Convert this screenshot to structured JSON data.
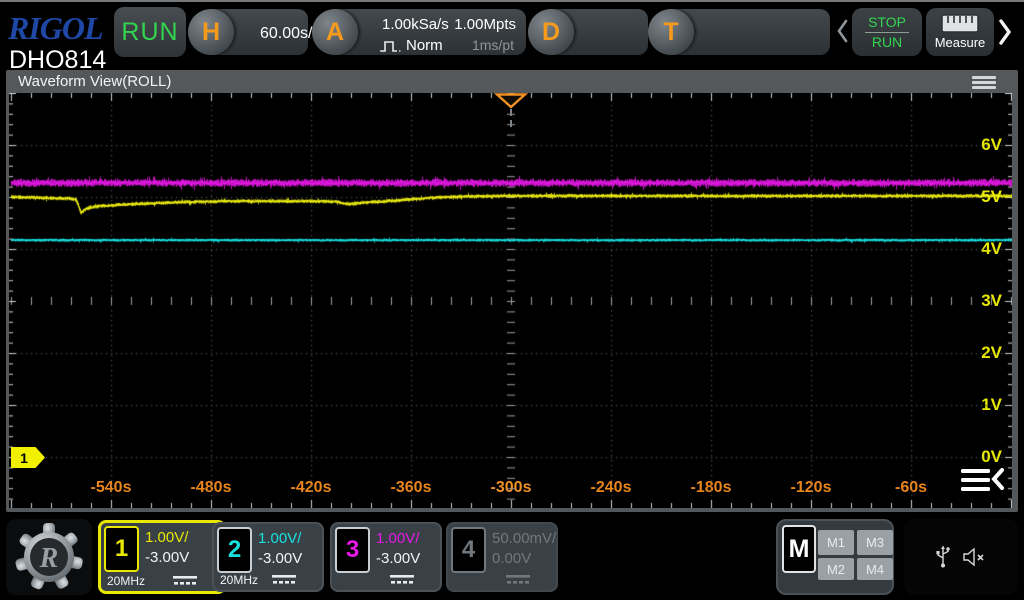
{
  "header": {
    "brand": "RIGOL",
    "model": "DHO814",
    "acq_state": "RUN",
    "horizontal": {
      "letter": "H",
      "timebase": "60.00s/"
    },
    "acquire": {
      "letter": "A",
      "sample_rate": "1.00kSa/s",
      "trigger_mode": "Norm",
      "mode_icon": "pulse-icon",
      "memory_depth": "1.00Mpts",
      "time_per_point": "1ms/pt"
    },
    "decode": {
      "letter": "D"
    },
    "trigger": {
      "letter": "T"
    },
    "stop_run_button": {
      "top": "STOP",
      "bottom": "RUN"
    },
    "measure_button": {
      "label": "Measure",
      "icon": "ruler-icon"
    },
    "nav_icons": [
      "prev-chevron-icon",
      "next-chevron-icon"
    ]
  },
  "panel": {
    "title": "Waveform View(ROLL)",
    "menu_icon": "hamburger-icon"
  },
  "chart_data": {
    "type": "line",
    "title": "Waveform View (ROLL)",
    "grid": "dotted",
    "x_axis": {
      "unit": "s",
      "range": [
        -600,
        0
      ],
      "seconds_per_div": 60,
      "tick_values": [
        -540,
        -480,
        -420,
        -360,
        -300,
        -240,
        -180,
        -120,
        -60
      ],
      "tick_labels": [
        "-540s",
        "-480s",
        "-420s",
        "-360s",
        "-300s",
        "-240s",
        "-180s",
        "-120s",
        "-60s"
      ]
    },
    "y_axis": {
      "unit": "V",
      "range": [
        -1,
        7
      ],
      "volts_per_div": 1,
      "tick_values": [
        6,
        5,
        4,
        3,
        2,
        1,
        0
      ],
      "tick_labels": [
        "6V",
        "5V",
        "4V",
        "3V",
        "2V",
        "1V",
        "0V"
      ]
    },
    "trigger_time_s": -300,
    "series": [
      {
        "name": "CH3",
        "color": "#e818e8",
        "noise_vpp": 0.16,
        "mean_v": 5.27,
        "points": [
          [
            -600,
            5.27
          ],
          [
            0,
            5.27
          ]
        ]
      },
      {
        "name": "CH2",
        "color": "#18e0e0",
        "noise_vpp": 0.06,
        "mean_v": 4.17,
        "points": [
          [
            -600,
            4.17
          ],
          [
            0,
            4.17
          ]
        ]
      },
      {
        "name": "CH1",
        "color": "#eeee12",
        "noise_vpp": 0.08,
        "mean_v": 5.0,
        "points": [
          [
            -600,
            5.0
          ],
          [
            -565,
            4.97
          ],
          [
            -561,
            4.95
          ],
          [
            -558,
            4.7
          ],
          [
            -555,
            4.78
          ],
          [
            -548,
            4.82
          ],
          [
            -530,
            4.86
          ],
          [
            -500,
            4.9
          ],
          [
            -470,
            4.92
          ],
          [
            -420,
            4.92
          ],
          [
            -405,
            4.91
          ],
          [
            -398,
            4.86
          ],
          [
            -390,
            4.89
          ],
          [
            -370,
            4.93
          ],
          [
            -350,
            4.98
          ],
          [
            -330,
            5.01
          ],
          [
            -300,
            5.02
          ],
          [
            0,
            5.02
          ]
        ]
      }
    ]
  },
  "plot": {
    "ch1_marker": "1",
    "trigger_icon": "trigger-marker-icon",
    "corner_icon": "menu-collapse-icon"
  },
  "channels": {
    "ch1": {
      "num": "1",
      "scale": "1.00V/",
      "offset": "-3.00V",
      "bandwidth": "20MHz",
      "coupling_icon": "dc-coupling-icon",
      "color": "#e8e800",
      "active": true,
      "selected": true
    },
    "ch2": {
      "num": "2",
      "scale": "1.00V/",
      "offset": "-3.00V",
      "bandwidth": "20MHz",
      "coupling_icon": "dc-coupling-icon",
      "color": "#18e0e0",
      "active": true
    },
    "ch3": {
      "num": "3",
      "scale": "1.00V/",
      "offset": "-3.00V",
      "coupling_icon": "dc-coupling-icon",
      "color": "#e818e8",
      "active": true
    },
    "ch4": {
      "num": "4",
      "scale": "50.00mV/",
      "offset": "0.00V",
      "coupling_icon": "dc-coupling-icon",
      "color": "#70787e",
      "active": false
    }
  },
  "math": {
    "label": "M",
    "buttons": [
      "M1",
      "M2",
      "M3",
      "M4"
    ]
  },
  "status": {
    "icons": [
      "usb-icon",
      "speaker-muted-icon"
    ],
    "logo_icon": "rigol-gear-icon"
  },
  "colors": {
    "accent_orange": "#f59a1d",
    "run_green": "#33d54e",
    "ch1_yellow": "#e8e800",
    "ch2_cyan": "#18e0e0",
    "ch3_magenta": "#e818e8",
    "disabled_gray": "#70787e",
    "titlebar_gray": "#54585b",
    "time_label_orange": "#ea851c"
  }
}
